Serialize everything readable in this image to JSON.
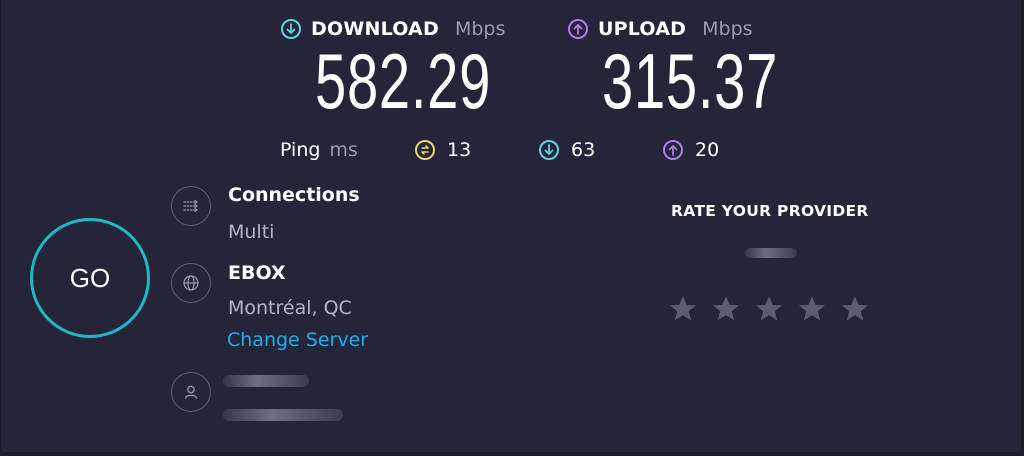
{
  "download": {
    "label": "DOWNLOAD",
    "unit": "Mbps",
    "value": "582.29",
    "icon": "download-arrow-icon",
    "color": "#5fd3dc"
  },
  "upload": {
    "label": "UPLOAD",
    "unit": "Mbps",
    "value": "315.37",
    "icon": "upload-arrow-icon",
    "color": "#b07ce6"
  },
  "ping": {
    "label": "Ping",
    "unit": "ms",
    "idle": {
      "value": "13",
      "icon": "idle-latency-icon",
      "color": "#e8d36a"
    },
    "download": {
      "value": "63",
      "icon": "download-latency-icon",
      "color": "#5fd3dc"
    },
    "upload": {
      "value": "20",
      "icon": "upload-latency-icon",
      "color": "#b07ce6"
    }
  },
  "go_button": {
    "label": "GO",
    "color": "#1fb8c8"
  },
  "connections": {
    "title": "Connections",
    "value": "Multi",
    "icon": "connections-icon"
  },
  "server": {
    "title": "EBOX",
    "location": "Montréal, QC",
    "change_label": "Change Server",
    "icon": "globe-icon",
    "link_color": "#1faee8"
  },
  "user": {
    "icon": "user-icon"
  },
  "rate": {
    "title": "RATE YOUR PROVIDER",
    "stars": 5
  }
}
